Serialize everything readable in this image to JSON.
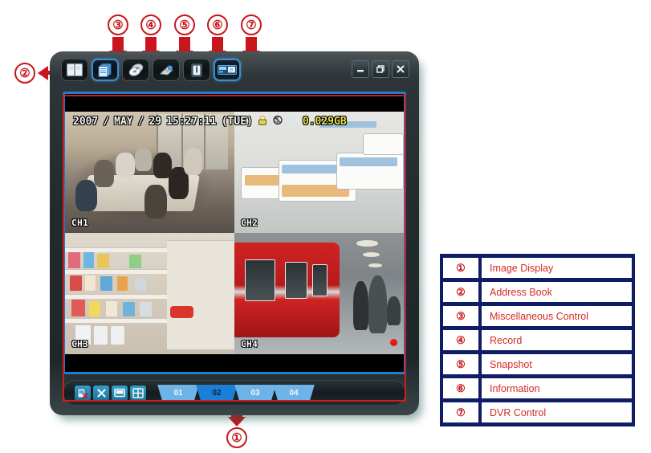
{
  "annotations": {
    "callouts": [
      {
        "id": "1",
        "symbol": "①"
      },
      {
        "id": "2",
        "symbol": "②"
      },
      {
        "id": "3",
        "symbol": "③"
      },
      {
        "id": "4",
        "symbol": "④"
      },
      {
        "id": "5",
        "symbol": "⑤"
      },
      {
        "id": "6",
        "symbol": "⑥"
      },
      {
        "id": "7",
        "symbol": "⑦"
      }
    ],
    "accent_color": "#c9151b"
  },
  "window": {
    "toolbar": [
      {
        "name": "address-book",
        "icon": "book-icon",
        "active": false
      },
      {
        "name": "image-display",
        "icon": "panels-icon",
        "active": true
      },
      {
        "name": "miscellaneous-control",
        "icon": "discs-icon",
        "active": false
      },
      {
        "name": "record",
        "icon": "hand-record-icon",
        "active": false
      },
      {
        "name": "information",
        "icon": "info-icon",
        "active": false
      },
      {
        "name": "dvr-control",
        "icon": "dvr-panel-icon",
        "active": true
      }
    ],
    "controls": [
      {
        "name": "minimize",
        "glyph": "—"
      },
      {
        "name": "restore",
        "glyph": "❐"
      },
      {
        "name": "close",
        "glyph": "✕"
      }
    ]
  },
  "osd": {
    "year": "2007",
    "separator1": "/",
    "month": "MAY",
    "separator2": "/",
    "day": "29",
    "time": "15:27:11",
    "weekday": "(TUE)",
    "lock_icon": "lock-icon",
    "mute_icon": "mute-icon",
    "zoom_icon": "magnifier-icon",
    "disk_size": "0.029GB",
    "full_text": "2007 / MAY / 29 15:27:11 (TUE)"
  },
  "channels": [
    {
      "id": "ch1",
      "label": "CH1",
      "scene": "meeting-room"
    },
    {
      "id": "ch2",
      "label": "CH2",
      "scene": "hospital-room"
    },
    {
      "id": "ch3",
      "label": "CH3",
      "scene": "supermarket-aisle"
    },
    {
      "id": "ch4",
      "label": "CH4",
      "scene": "subway-platform"
    }
  ],
  "bottom_bar": {
    "icons": [
      {
        "name": "snapshot-delete-icon"
      },
      {
        "name": "close-x-icon"
      },
      {
        "name": "single-pane-icon"
      },
      {
        "name": "quad-pane-icon"
      }
    ],
    "tabs": [
      {
        "label": "01",
        "selected": false
      },
      {
        "label": "02",
        "selected": true
      },
      {
        "label": "03",
        "selected": false
      },
      {
        "label": "04",
        "selected": false
      }
    ]
  },
  "legend": {
    "rows": [
      {
        "num": "①",
        "label": "Image Display"
      },
      {
        "num": "②",
        "label": "Address Book"
      },
      {
        "num": "③",
        "label": "Miscellaneous Control"
      },
      {
        "num": "④",
        "label": "Record"
      },
      {
        "num": "⑤",
        "label": "Snapshot"
      },
      {
        "num": "⑥",
        "label": "Information"
      },
      {
        "num": "⑦",
        "label": "DVR Control"
      }
    ],
    "bar_color": "#0f1c66",
    "text_color": "#d42a22"
  }
}
